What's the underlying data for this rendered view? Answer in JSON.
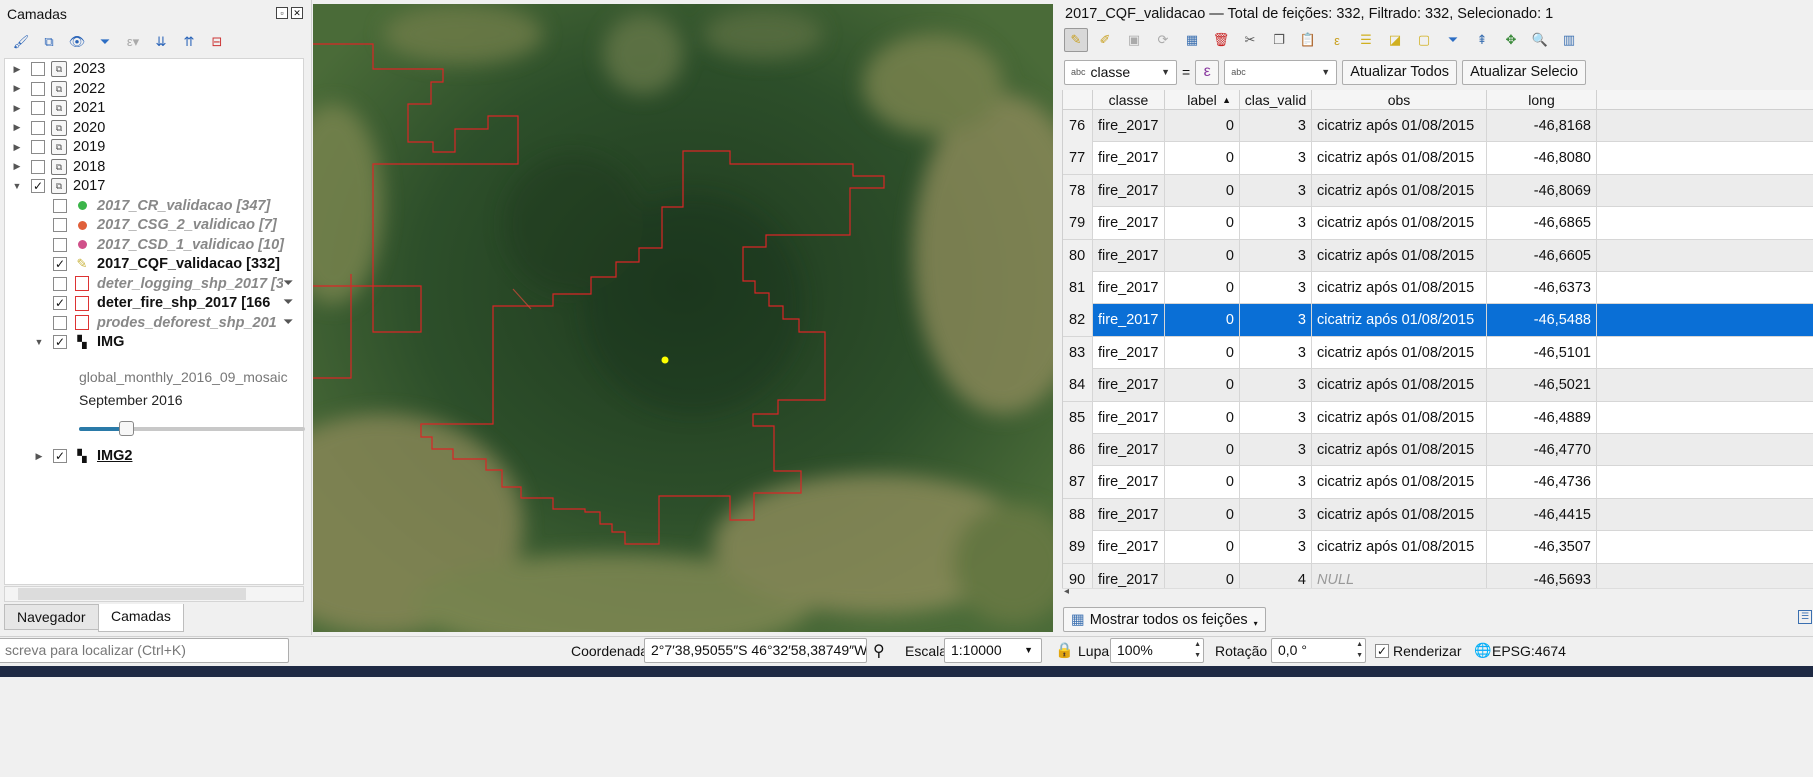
{
  "layers_panel": {
    "title": "Camadas",
    "groups": [
      {
        "label": "2023",
        "checked": false
      },
      {
        "label": "2022",
        "checked": false
      },
      {
        "label": "2021",
        "checked": false
      },
      {
        "label": "2020",
        "checked": false
      },
      {
        "label": "2019",
        "checked": false
      },
      {
        "label": "2018",
        "checked": false
      },
      {
        "label": "2017",
        "checked": true
      }
    ],
    "layers_2017": [
      {
        "label": "2017_CR_validacao [347]",
        "checked": false,
        "symbol_color": "#3bb54a"
      },
      {
        "label": "2017_CSG_2_validicao [7]",
        "checked": false,
        "symbol_color": "#e0603a"
      },
      {
        "label": "2017_CSD_1_validicao [10]",
        "checked": false,
        "symbol_color": "#d0508a"
      },
      {
        "label": "2017_CQF_validacao [332]",
        "checked": true,
        "symbol_color": "#c8b23a"
      },
      {
        "label": "deter_logging_shp_2017 [3",
        "checked": false
      },
      {
        "label": "deter_fire_shp_2017 [166",
        "checked": true
      },
      {
        "label": "prodes_deforest_shp_201",
        "checked": false
      }
    ],
    "img_layer": {
      "label": "IMG",
      "checked": true,
      "subtitle": "global_monthly_2016_09_mosaic",
      "date": "September 2016",
      "slider_position": 0.21
    },
    "img2_layer": {
      "label": "IMG2",
      "checked": true
    },
    "tabs": [
      "Navegador",
      "Camadas"
    ],
    "active_tab": "Camadas"
  },
  "attribute_table": {
    "title": "2017_CQF_validacao — Total de feições: 332, Filtrado: 332, Selecionado: 1",
    "field_combo": "classe",
    "field_type_label": "abc",
    "equals": "=",
    "value_type_label": "abc",
    "update_all_button": "Atualizar Todos",
    "update_selected_button": "Atualizar Selecio",
    "columns": [
      "classe",
      "label",
      "clas_valid",
      "obs",
      "long"
    ],
    "rows": [
      {
        "n": "76",
        "classe": "fire_2017",
        "label": "0",
        "clas_valid": "3",
        "obs": "cicatriz após 01/08/2015",
        "long": "-46,8168"
      },
      {
        "n": "77",
        "classe": "fire_2017",
        "label": "0",
        "clas_valid": "3",
        "obs": "cicatriz após 01/08/2015",
        "long": "-46,8080"
      },
      {
        "n": "78",
        "classe": "fire_2017",
        "label": "0",
        "clas_valid": "3",
        "obs": "cicatriz após 01/08/2015",
        "long": "-46,8069"
      },
      {
        "n": "79",
        "classe": "fire_2017",
        "label": "0",
        "clas_valid": "3",
        "obs": "cicatriz após 01/08/2015",
        "long": "-46,6865"
      },
      {
        "n": "80",
        "classe": "fire_2017",
        "label": "0",
        "clas_valid": "3",
        "obs": "cicatriz após 01/08/2015",
        "long": "-46,6605"
      },
      {
        "n": "81",
        "classe": "fire_2017",
        "label": "0",
        "clas_valid": "3",
        "obs": "cicatriz após 01/08/2015",
        "long": "-46,6373"
      },
      {
        "n": "82",
        "classe": "fire_2017",
        "label": "0",
        "clas_valid": "3",
        "obs": "cicatriz após 01/08/2015",
        "long": "-46,5488",
        "selected": true
      },
      {
        "n": "83",
        "classe": "fire_2017",
        "label": "0",
        "clas_valid": "3",
        "obs": "cicatriz após 01/08/2015",
        "long": "-46,5101"
      },
      {
        "n": "84",
        "classe": "fire_2017",
        "label": "0",
        "clas_valid": "3",
        "obs": "cicatriz após 01/08/2015",
        "long": "-46,5021"
      },
      {
        "n": "85",
        "classe": "fire_2017",
        "label": "0",
        "clas_valid": "3",
        "obs": "cicatriz após 01/08/2015",
        "long": "-46,4889"
      },
      {
        "n": "86",
        "classe": "fire_2017",
        "label": "0",
        "clas_valid": "3",
        "obs": "cicatriz após 01/08/2015",
        "long": "-46,4770"
      },
      {
        "n": "87",
        "classe": "fire_2017",
        "label": "0",
        "clas_valid": "3",
        "obs": "cicatriz após 01/08/2015",
        "long": "-46,4736"
      },
      {
        "n": "88",
        "classe": "fire_2017",
        "label": "0",
        "clas_valid": "3",
        "obs": "cicatriz após 01/08/2015",
        "long": "-46,4415"
      },
      {
        "n": "89",
        "classe": "fire_2017",
        "label": "0",
        "clas_valid": "3",
        "obs": "cicatriz após 01/08/2015",
        "long": "-46,3507"
      },
      {
        "n": "90",
        "classe": "fire_2017",
        "label": "0",
        "clas_valid": "4",
        "obs": "NULL",
        "long": "-46,5693"
      }
    ],
    "show_all_button": "Mostrar todos os feições"
  },
  "statusbar": {
    "locator_placeholder": "screva para localizar (Ctrl+K)",
    "coord_label": "Coordenada",
    "coord_value": "2°7′38,95055″S 46°32′58,38749″W",
    "scale_label": "Escala",
    "scale_value": "1:10000",
    "magnifier_label": "Lupa",
    "magnifier_value": "100%",
    "rotation_label": "Rotação",
    "rotation_value": "0,0 °",
    "render_label": "Renderizar",
    "render_checked": true,
    "crs": "EPSG:4674"
  },
  "colors": {
    "selection": "#0a6fd6",
    "polygon_outline": "#d92626",
    "point": "#ffff00"
  }
}
